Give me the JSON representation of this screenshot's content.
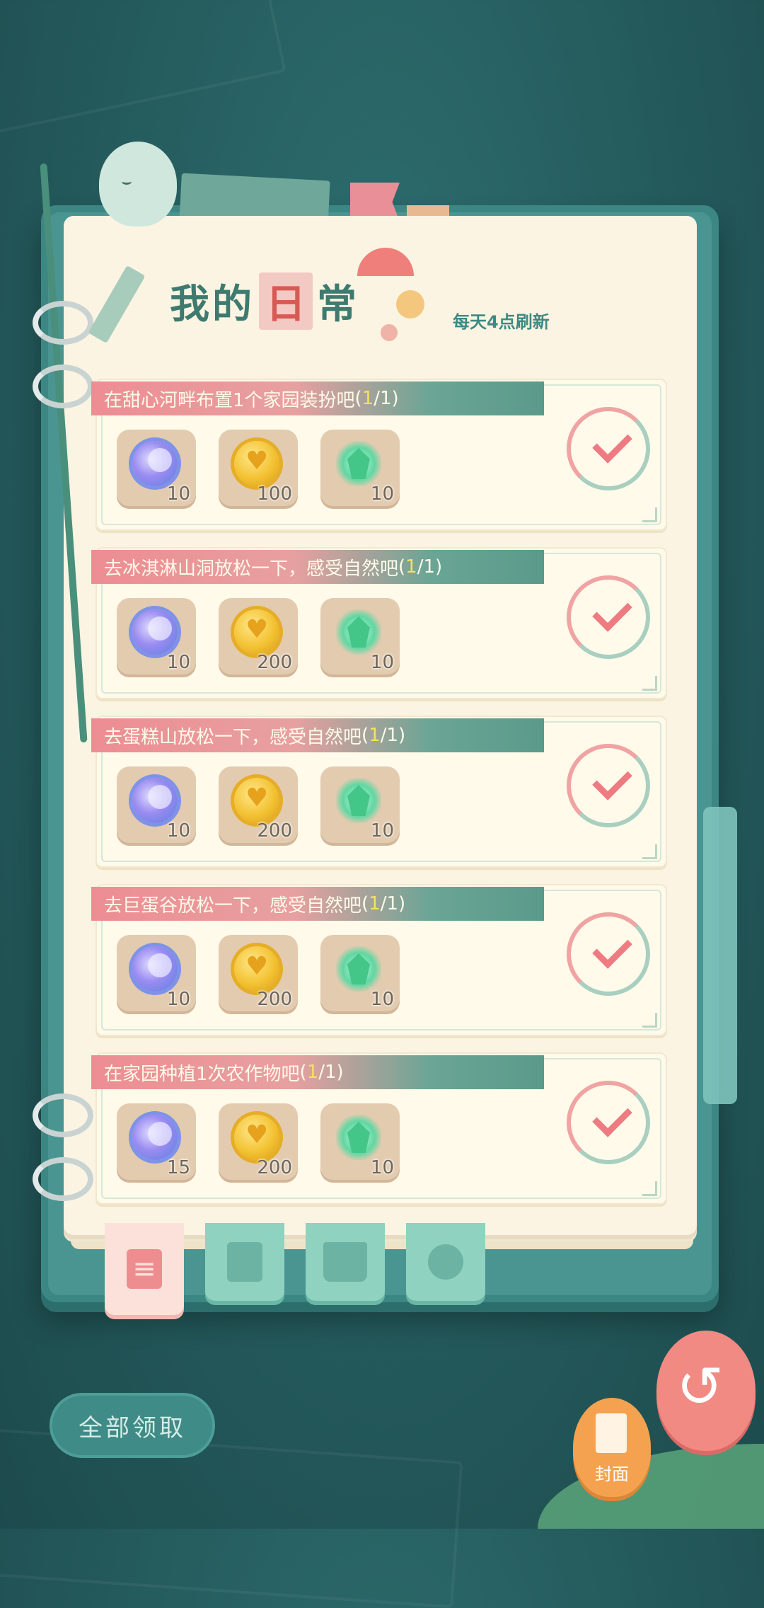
{
  "header": {
    "title_part1": "我的",
    "title_highlight": "日",
    "title_part2": "常",
    "refresh_note": "每天4点刷新"
  },
  "tasks": [
    {
      "title": "在甜心河畔布置1个家园装扮吧",
      "progress_open": "(",
      "progress_done": "1",
      "progress_rest": "/1)",
      "rewards": [
        {
          "icon": "moon-crystal-icon",
          "count": "10"
        },
        {
          "icon": "gold-coin-icon",
          "count": "100"
        },
        {
          "icon": "green-gem-icon",
          "count": "10"
        }
      ],
      "completed": true
    },
    {
      "title": "去冰淇淋山洞放松一下，感受自然吧",
      "progress_open": "(",
      "progress_done": "1",
      "progress_rest": "/1)",
      "rewards": [
        {
          "icon": "moon-crystal-icon",
          "count": "10"
        },
        {
          "icon": "gold-coin-icon",
          "count": "200"
        },
        {
          "icon": "green-gem-icon",
          "count": "10"
        }
      ],
      "completed": true
    },
    {
      "title": "去蛋糕山放松一下，感受自然吧",
      "progress_open": "(",
      "progress_done": "1",
      "progress_rest": "/1)",
      "rewards": [
        {
          "icon": "moon-crystal-icon",
          "count": "10"
        },
        {
          "icon": "gold-coin-icon",
          "count": "200"
        },
        {
          "icon": "green-gem-icon",
          "count": "10"
        }
      ],
      "completed": true
    },
    {
      "title": "去巨蛋谷放松一下，感受自然吧",
      "progress_open": "(",
      "progress_done": "1",
      "progress_rest": "/1)",
      "rewards": [
        {
          "icon": "moon-crystal-icon",
          "count": "10"
        },
        {
          "icon": "gold-coin-icon",
          "count": "200"
        },
        {
          "icon": "green-gem-icon",
          "count": "10"
        }
      ],
      "completed": true
    },
    {
      "title": "在家园种植1次农作物吧",
      "progress_open": "(",
      "progress_done": "1",
      "progress_rest": "/1)",
      "rewards": [
        {
          "icon": "moon-crystal-icon",
          "count": "15"
        },
        {
          "icon": "gold-coin-icon",
          "count": "200"
        },
        {
          "icon": "green-gem-icon",
          "count": "10"
        }
      ],
      "completed": true
    }
  ],
  "tabs": [
    {
      "icon": "daily-list-icon",
      "active": true
    },
    {
      "icon": "photo-card-icon",
      "active": false
    },
    {
      "icon": "open-book-icon",
      "active": false
    },
    {
      "icon": "flower-medal-icon",
      "active": false
    }
  ],
  "buttons": {
    "claim_all": "全部领取",
    "cover_label": "封面",
    "back_icon": "return-arrow-icon"
  },
  "colors": {
    "background": "#245a5c",
    "page": "#fbf4e2",
    "banner_pink": "#ed8d93",
    "banner_green": "#5b9a8b",
    "progress_highlight": "#f6e25a",
    "check": "#ee7b82"
  }
}
